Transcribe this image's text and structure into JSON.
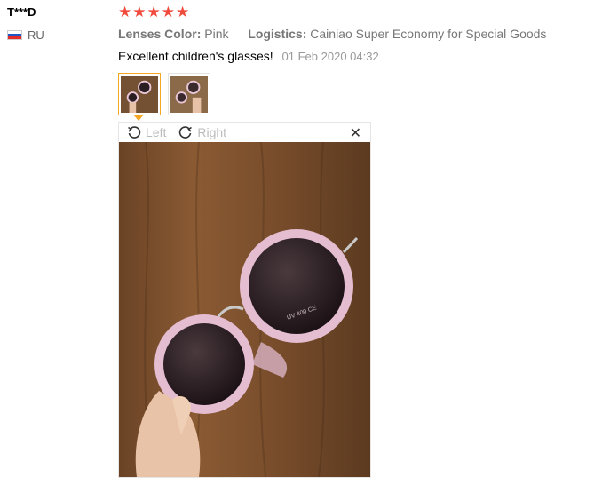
{
  "reviewer": {
    "name": "T***D",
    "country": "RU"
  },
  "rating": {
    "stars": 5,
    "max": 5,
    "star_glyph": "★",
    "color": "#f04a3c"
  },
  "attributes": [
    {
      "label": "Lenses Color:",
      "value": "Pink"
    },
    {
      "label": "Logistics:",
      "value": "Cainiao Super Economy for Special Goods"
    }
  ],
  "review": {
    "text": "Excellent children's glasses!",
    "date": "01 Feb 2020 04:32"
  },
  "thumbnails": [
    {
      "name": "photo-1",
      "active": true
    },
    {
      "name": "photo-2",
      "active": false
    }
  ],
  "viewer": {
    "rotate_left_label": "Left",
    "rotate_right_label": "Right",
    "close_glyph": "✕"
  },
  "icons": {
    "rotate_left": "rotate-left-icon",
    "rotate_right": "rotate-right-icon",
    "close": "close-icon",
    "flag": "russia-flag-icon"
  },
  "colors": {
    "accent": "#f5a623",
    "star": "#f04a3c",
    "muted": "#777777"
  }
}
